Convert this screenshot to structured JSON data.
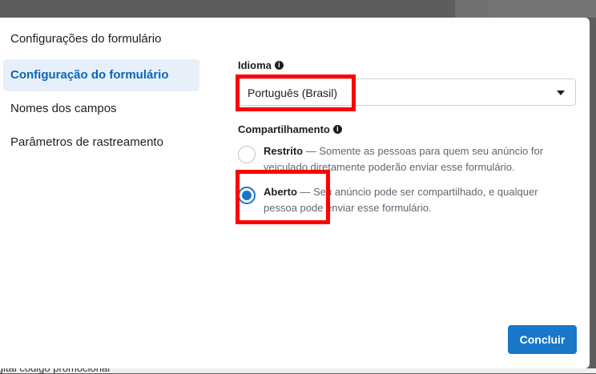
{
  "background": {
    "bottom_text": "igital código promocional"
  },
  "modal": {
    "title": "Configurações do formulário",
    "sidebar": [
      {
        "label": "Configuração do formulário",
        "active": true
      },
      {
        "label": "Nomes dos campos",
        "active": false
      },
      {
        "label": "Parâmetros de rastreamento",
        "active": false
      }
    ],
    "language": {
      "label": "Idioma",
      "value": "Português (Brasil)"
    },
    "sharing": {
      "label": "Compartilhamento",
      "options": [
        {
          "title": "Restrito",
          "description": " — Somente as pessoas para quem seu anúncio for veiculado diretamente poderão enviar esse formulário.",
          "checked": false
        },
        {
          "title": "Aberto",
          "description": " — Seu anúncio pode ser compartilhado, e qualquer pessoa pode enviar esse formulário.",
          "checked": true
        }
      ]
    },
    "done_button": "Concluir"
  },
  "colors": {
    "accent": "#1877c9",
    "active_bg": "#e7f0fa",
    "highlight": "#ff0000"
  }
}
